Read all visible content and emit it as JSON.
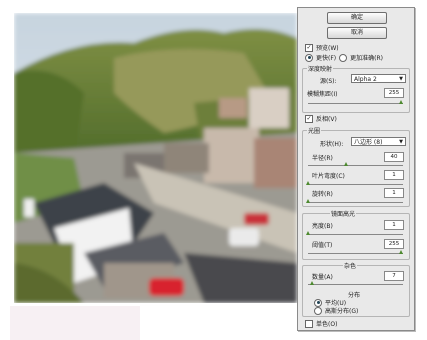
{
  "dialog": {
    "ok_label": "确定",
    "cancel_label": "取消",
    "preview_label": "预览(W)",
    "faster_label": "更快(F)",
    "more_accurate_label": "更加准确(R)"
  },
  "depth_map": {
    "title": "深度映射",
    "source_label": "源(S):",
    "source_value": "Alpha 2",
    "blur_focus_label": "模糊焦距(I)",
    "blur_focus_value": "255",
    "blur_focus_level": 0.98,
    "invert_label": "反相(V)"
  },
  "iris": {
    "title": "光圈",
    "shape_label": "形状(H):",
    "shape_value": "八边形 (8)",
    "radius_label": "半径(R)",
    "radius_value": "40",
    "radius_level": 0.4,
    "curvature_label": "叶片弯度(C)",
    "curvature_value": "1",
    "curvature_level": 0.01,
    "rotation_label": "旋转(R)",
    "rotation_value": "1",
    "rotation_level": 0.01
  },
  "specular": {
    "title": "镜面高光",
    "brightness_label": "亮度(B)",
    "brightness_value": "1",
    "brightness_level": 0.01,
    "threshold_label": "阈值(T)",
    "threshold_value": "255",
    "threshold_level": 0.98
  },
  "noise": {
    "title": "杂色",
    "amount_label": "数量(A)",
    "amount_value": "7",
    "amount_level": 0.05,
    "distribution_title": "分布",
    "uniform_label": "平均(U)",
    "gaussian_label": "高斯分布(G)",
    "monochromatic_label": "单色(O)"
  },
  "colors": {
    "thumb": "#4d8a2f"
  }
}
